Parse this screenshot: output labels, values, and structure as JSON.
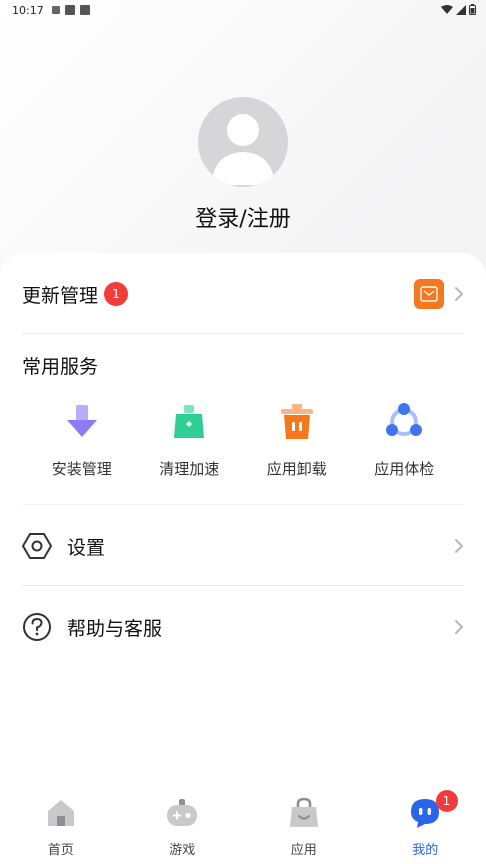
{
  "status_bar": {
    "time": "10:17"
  },
  "profile": {
    "login_label": "登录/注册"
  },
  "update": {
    "title": "更新管理",
    "badge_count": "1"
  },
  "services": {
    "title": "常用服务",
    "items": [
      {
        "label": "安装管理",
        "icon": "install-icon"
      },
      {
        "label": "清理加速",
        "icon": "clean-icon"
      },
      {
        "label": "应用卸载",
        "icon": "uninstall-icon"
      },
      {
        "label": "应用体检",
        "icon": "checkup-icon"
      }
    ]
  },
  "settings": {
    "label": "设置"
  },
  "help": {
    "label": "帮助与客服"
  },
  "nav": {
    "items": [
      {
        "label": "首页",
        "icon": "home-icon"
      },
      {
        "label": "游戏",
        "icon": "gamepad-icon"
      },
      {
        "label": "应用",
        "icon": "bag-icon"
      },
      {
        "label": "我的",
        "icon": "profile-mascot-icon"
      }
    ],
    "active_index": 3,
    "mine_badge": "1"
  },
  "colors": {
    "accent": "#2a64e8",
    "badge": "#f23b3b",
    "orange": "#f5781f",
    "green": "#2dcf92",
    "purple": "#8a7cf6",
    "blue": "#3f76f0"
  }
}
